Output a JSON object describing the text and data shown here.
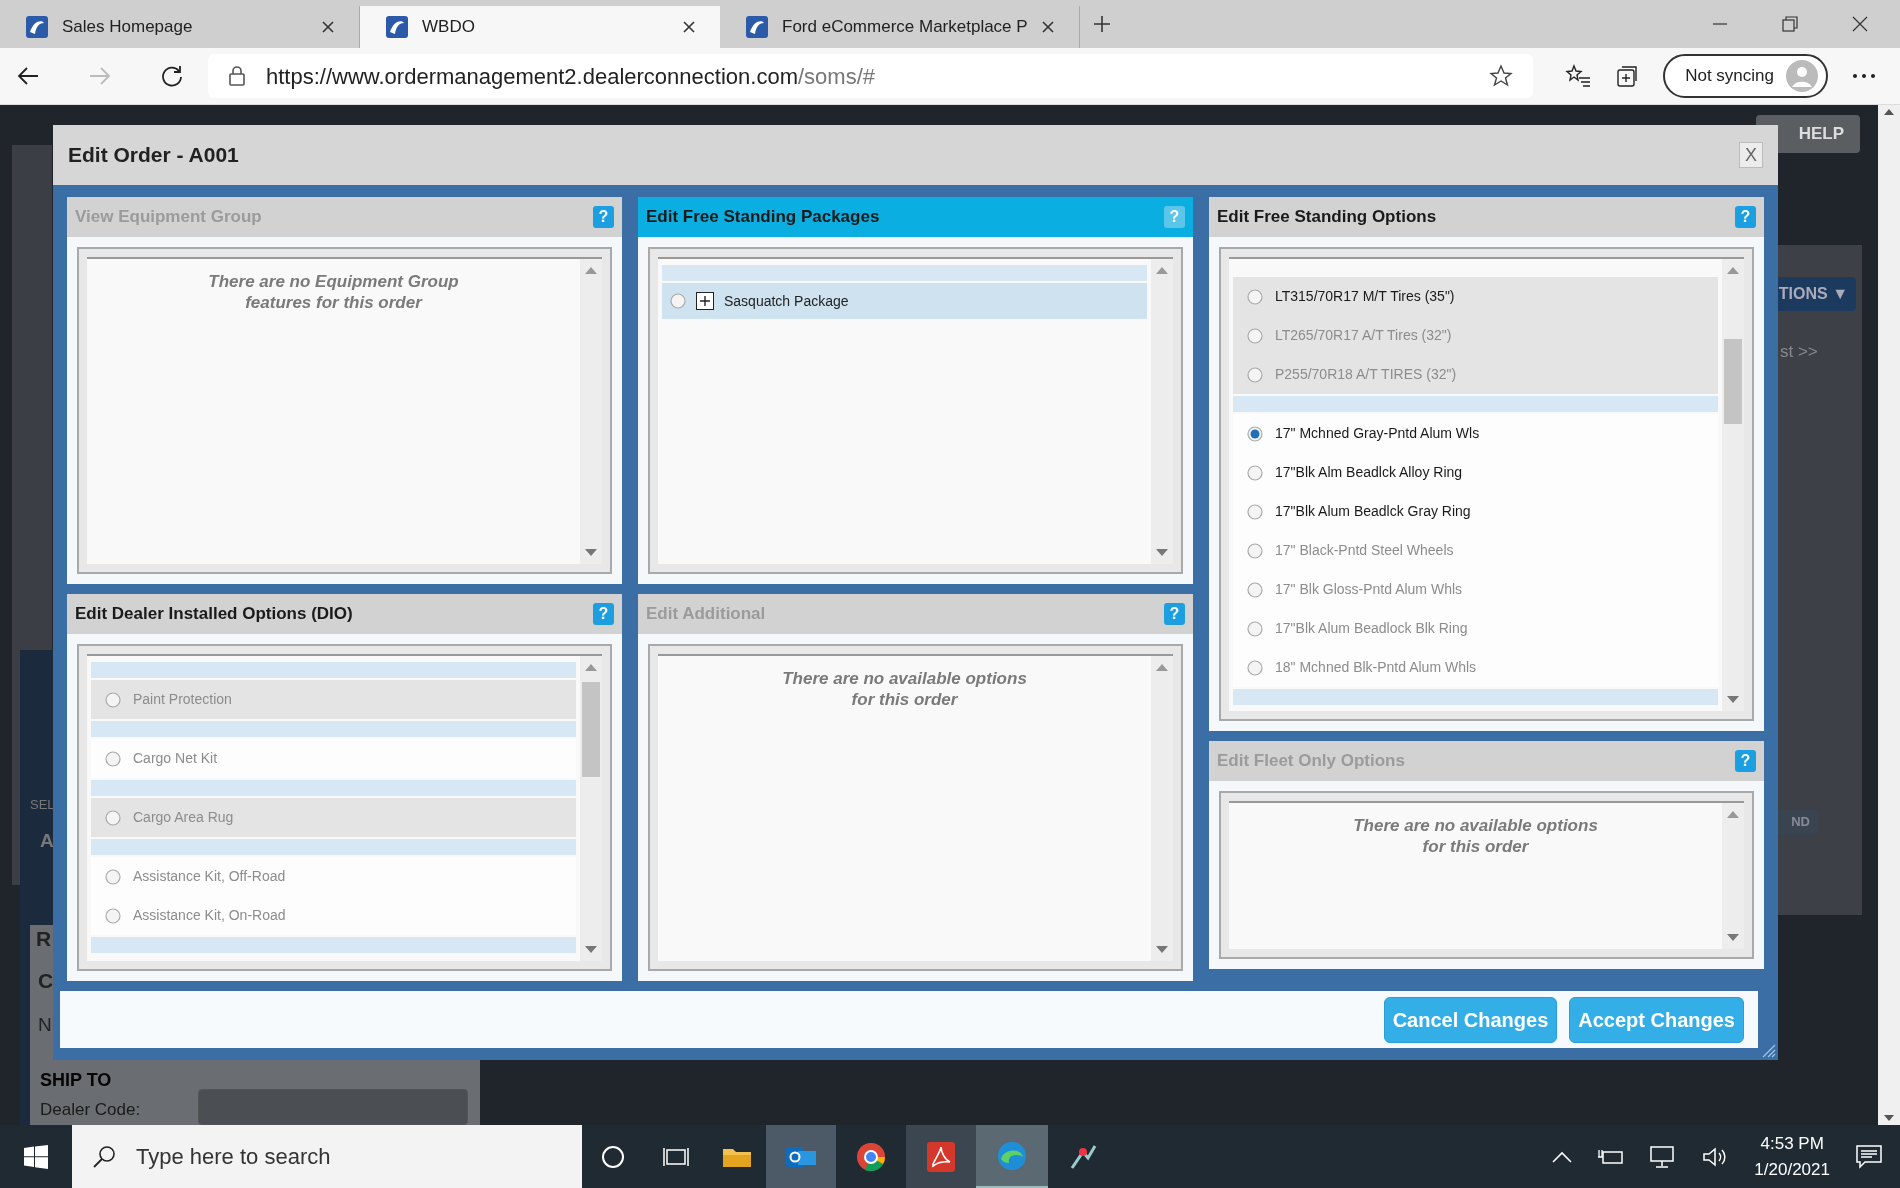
{
  "browser": {
    "tabs": [
      {
        "title": "Sales Homepage",
        "selected": false
      },
      {
        "title": "WBDO",
        "selected": true
      },
      {
        "title": "Ford eCommerce Marketplace P",
        "selected": false
      }
    ],
    "address": {
      "host": "https://www.ordermanagement2.dealerconnection.com",
      "path": "/soms/#"
    },
    "sync_button": "Not syncing"
  },
  "background_page": {
    "help": "HELP",
    "menu": "TIONS ▼",
    "link": "st >>",
    "badge": "ND",
    "fragments": [
      "SEL",
      "A",
      "R",
      "C",
      "N"
    ],
    "ship_to": "SHIP TO",
    "dealer_code_label": "Dealer Code:"
  },
  "dialog": {
    "title": "Edit Order - A001",
    "close": "X",
    "columns": [
      {
        "panels": [
          {
            "title": "View Equipment Group",
            "disabled": true,
            "highlighted": false,
            "help": "?",
            "message": "There are no Equipment Group features for this order"
          },
          {
            "title": "Edit Dealer Installed Options (DIO)",
            "disabled": false,
            "highlighted": false,
            "help": "?",
            "items": [
              {
                "kind": "separator"
              },
              {
                "kind": "option",
                "label": "Paint Protection",
                "selected": false,
                "disabled": true,
                "shaded": true
              },
              {
                "kind": "separator"
              },
              {
                "kind": "option",
                "label": "Cargo Net Kit",
                "selected": false,
                "disabled": true,
                "shaded": false
              },
              {
                "kind": "separator"
              },
              {
                "kind": "option",
                "label": "Cargo Area Rug",
                "selected": false,
                "disabled": true,
                "shaded": true
              },
              {
                "kind": "separator"
              },
              {
                "kind": "option",
                "label": "Assistance Kit, Off-Road",
                "selected": false,
                "disabled": true,
                "shaded": false
              },
              {
                "kind": "option",
                "label": "Assistance Kit, On-Road",
                "selected": false,
                "disabled": true,
                "shaded": false
              },
              {
                "kind": "separator"
              }
            ]
          }
        ]
      },
      {
        "panels": [
          {
            "title": "Edit Free Standing Packages",
            "disabled": false,
            "highlighted": true,
            "help": "?",
            "items": [
              {
                "kind": "separator"
              },
              {
                "kind": "package",
                "label": "Sasquatch Package",
                "selected": false
              }
            ]
          },
          {
            "title": "Edit Additional",
            "disabled": true,
            "highlighted": false,
            "help": "?",
            "message": "There are no available options for this order"
          }
        ]
      },
      {
        "panels": [
          {
            "title": "Edit Free Standing Options",
            "disabled": false,
            "highlighted": false,
            "help": "?",
            "items": [
              {
                "kind": "option",
                "label": "LT315/70R17 M/T Tires (35\")",
                "selected": false,
                "disabled": false,
                "shaded": true
              },
              {
                "kind": "option",
                "label": "LT265/70R17 A/T Tires (32\")",
                "selected": false,
                "disabled": true,
                "shaded": true
              },
              {
                "kind": "option",
                "label": "P255/70R18 A/T TIRES (32\")",
                "selected": false,
                "disabled": true,
                "shaded": true
              },
              {
                "kind": "separator"
              },
              {
                "kind": "option",
                "label": "17\" Mchned Gray-Pntd Alum Wls",
                "selected": true,
                "disabled": false,
                "shaded": false
              },
              {
                "kind": "option",
                "label": "17\"Blk Alm Beadlck Alloy Ring",
                "selected": false,
                "disabled": false,
                "shaded": false
              },
              {
                "kind": "option",
                "label": "17\"Blk Alum Beadlck Gray Ring",
                "selected": false,
                "disabled": false,
                "shaded": false
              },
              {
                "kind": "option",
                "label": "17\" Black-Pntd Steel Wheels",
                "selected": false,
                "disabled": true,
                "shaded": false
              },
              {
                "kind": "option",
                "label": "17\" Blk Gloss-Pntd Alum Whls",
                "selected": false,
                "disabled": true,
                "shaded": false
              },
              {
                "kind": "option",
                "label": "17\"Blk Alum Beadlock Blk Ring",
                "selected": false,
                "disabled": true,
                "shaded": false
              },
              {
                "kind": "option",
                "label": "18\" Mchned Blk-Pntd Alum Whls",
                "selected": false,
                "disabled": true,
                "shaded": false
              },
              {
                "kind": "separator"
              }
            ]
          },
          {
            "title": "Edit Fleet Only Options",
            "disabled": true,
            "highlighted": false,
            "help": "?",
            "message": "There are no available options for this order"
          }
        ]
      }
    ],
    "buttons": [
      {
        "label": "Cancel Changes"
      },
      {
        "label": "Accept Changes"
      }
    ]
  },
  "taskbar": {
    "search_placeholder": "Type here to search",
    "time": "4:53 PM",
    "date": "1/20/2021"
  }
}
